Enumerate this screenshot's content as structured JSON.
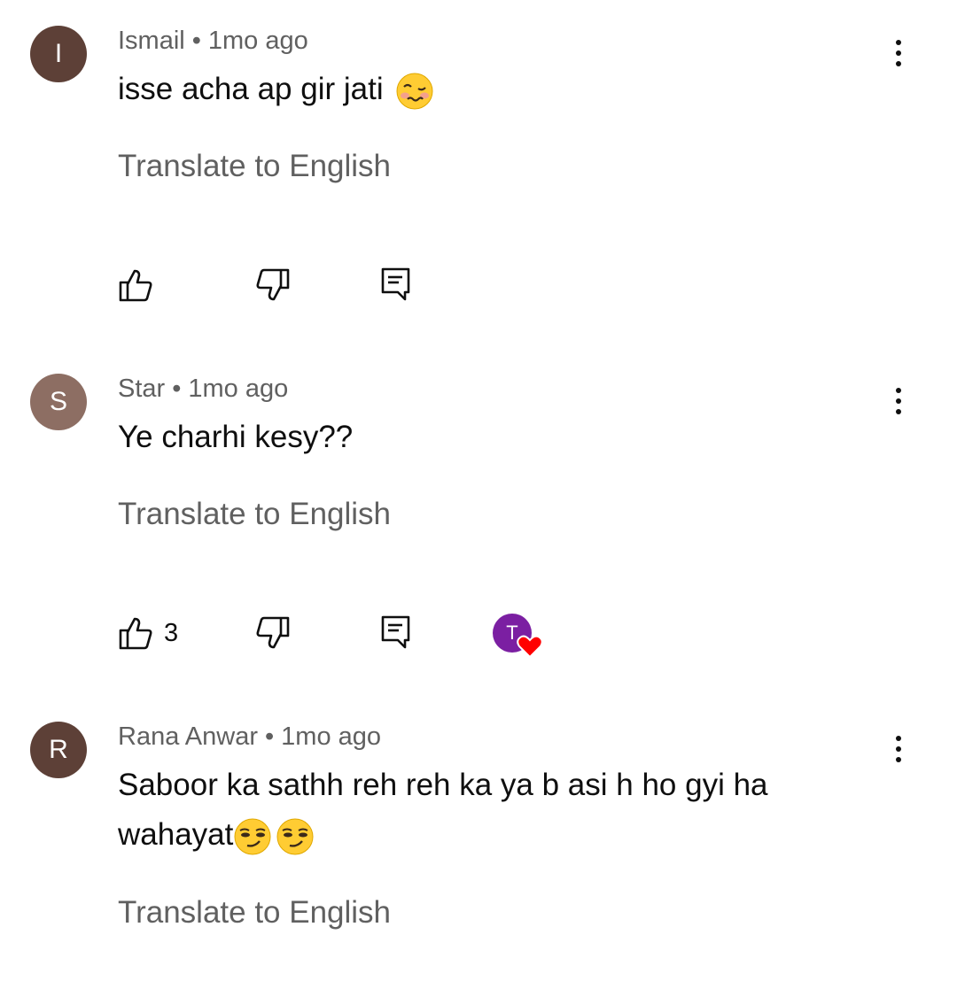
{
  "comments": [
    {
      "avatar_letter": "I",
      "avatar_color": "#5d4037",
      "author": "Ismail",
      "separator": "•",
      "time": "1mo ago",
      "text": "isse acha ap gir jati",
      "emoji": "woozy-face",
      "translate_label": "Translate to English",
      "likes": "",
      "hearted": false
    },
    {
      "avatar_letter": "S",
      "avatar_color": "#8d6e63",
      "author": "Star",
      "separator": "•",
      "time": "1mo ago",
      "text": "Ye charhi kesy??",
      "translate_label": "Translate to English",
      "likes": "3",
      "hearted": true,
      "heart_avatar_letter": "T",
      "heart_avatar_color": "#7b1fa2",
      "heart_color": "#ff0000"
    },
    {
      "avatar_letter": "R",
      "avatar_color": "#5d4037",
      "author": "Rana Anwar",
      "separator": "•",
      "time": "1mo ago",
      "text_line1": "Saboor ka sathh reh reh ka ya b asi h ho gyi ha",
      "text_line2": "wahayat",
      "emoji": "smirking-face",
      "translate_label": "Translate to English"
    }
  ]
}
